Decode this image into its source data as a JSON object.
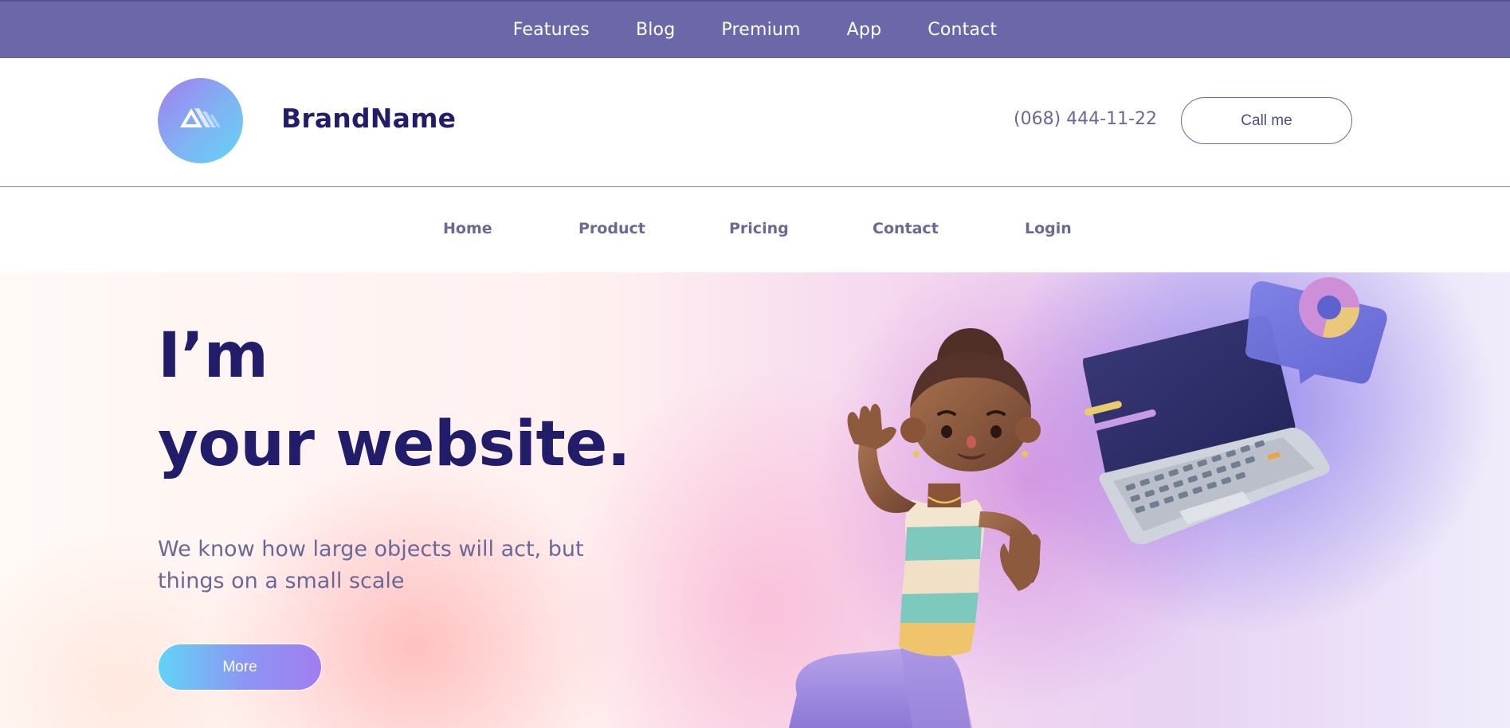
{
  "topnav": {
    "items": [
      "Features",
      "Blog",
      "Premium",
      "App",
      "Contact"
    ]
  },
  "header": {
    "brand": "BrandName",
    "phone": "(068) 444-11-22",
    "cta_label": "Call me",
    "logo_icon": "triangle-stripes-logo-icon"
  },
  "mainnav": {
    "items": [
      "Home",
      "Product",
      "Pricing",
      "Contact",
      "Login"
    ]
  },
  "hero": {
    "title_line1": "I’m",
    "title_line2": "your website.",
    "subtitle": "We know how large objects will act, but things on a small scale",
    "button_label": "More",
    "illustration": "3d-girl-with-laptop-illustration"
  },
  "colors": {
    "topbar": "#6c67a8",
    "brand_text": "#211d6b",
    "nav_text": "#6a6897",
    "accent_gradient_start": "#63d3f6",
    "accent_gradient_end": "#a27df0"
  }
}
